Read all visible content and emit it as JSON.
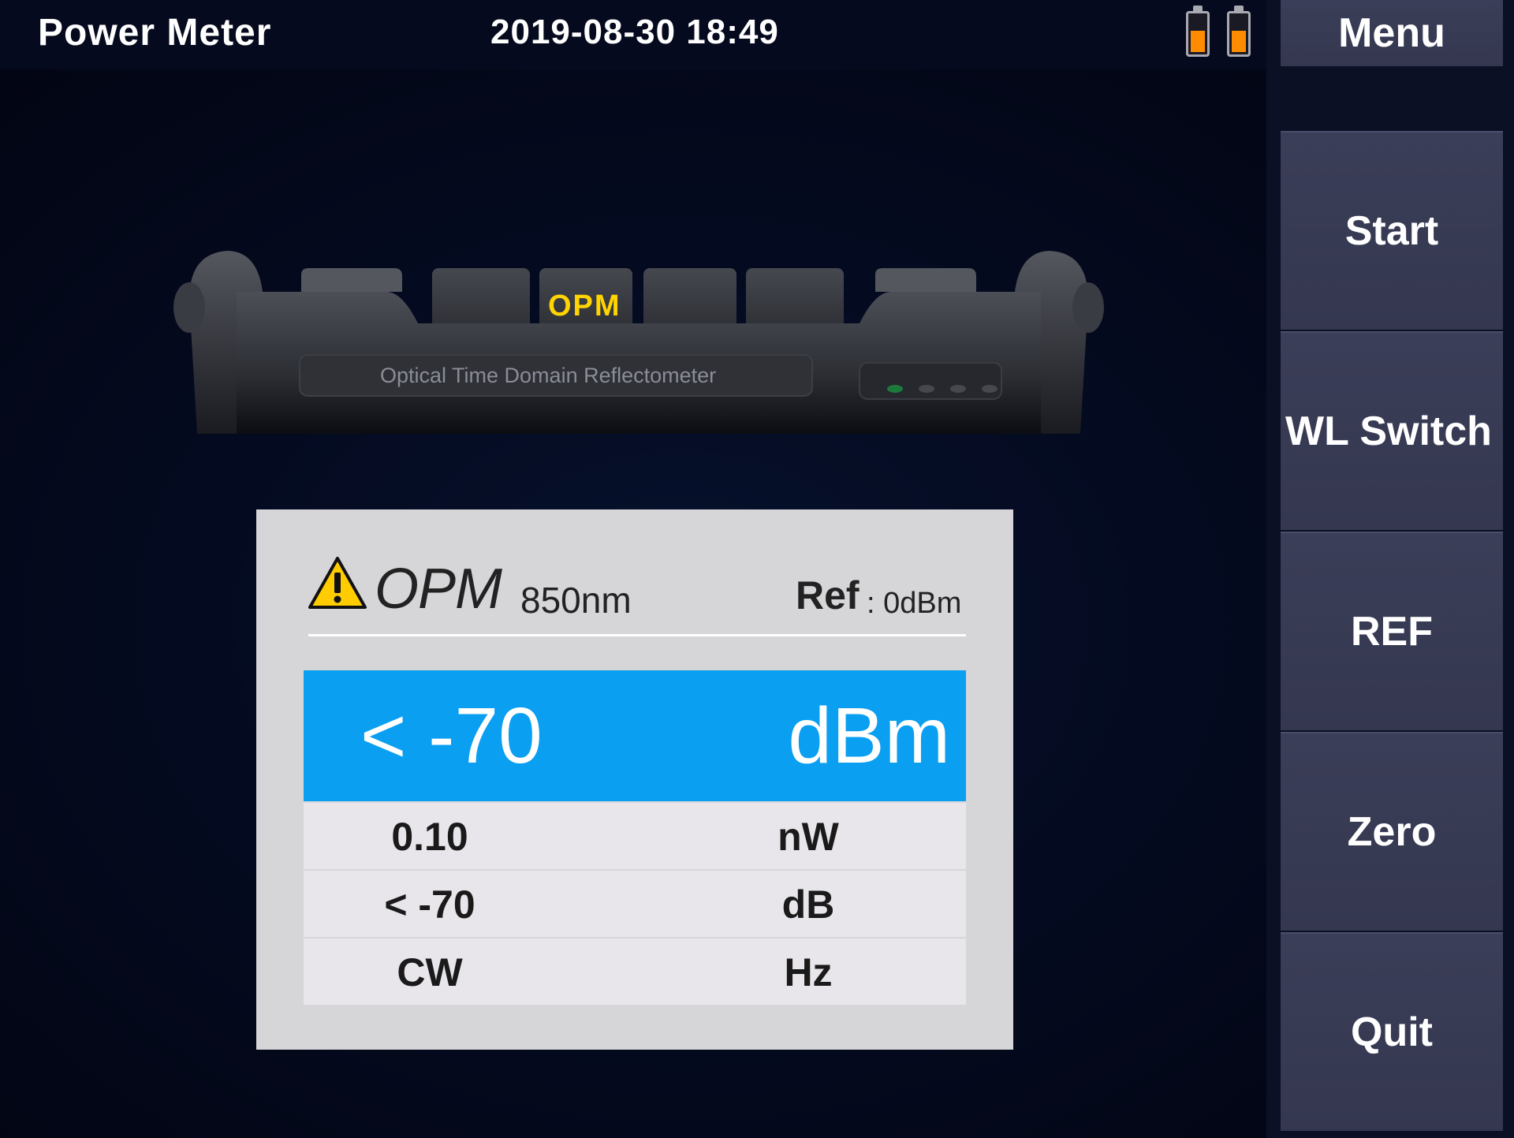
{
  "header": {
    "title": "Power Meter",
    "datetime": "2019-08-30 18:49",
    "battery_icons": [
      "battery-icon",
      "battery-icon"
    ],
    "battery_color": "#ff8c00"
  },
  "sidebar": {
    "menu_label": "Menu",
    "buttons": [
      {
        "label": "Start"
      },
      {
        "label": "WL Switch"
      },
      {
        "label": "REF"
      },
      {
        "label": "Zero"
      },
      {
        "label": "Quit"
      }
    ]
  },
  "device": {
    "mode_label": "OPM",
    "caption": "Optical Time Domain Reflectometer"
  },
  "meter": {
    "mode": "OPM",
    "wavelength": "850nm",
    "ref_label": "Ref",
    "ref_value": ": 0dBm",
    "warning_icon": "warning-icon",
    "primary": {
      "value": "< -70",
      "unit": "dBm"
    },
    "rows": [
      {
        "value": "0.10",
        "unit": "nW"
      },
      {
        "value": "< -70",
        "unit": "dB"
      },
      {
        "value": "CW",
        "unit": "Hz"
      }
    ],
    "accent_color": "#0a9ff0"
  }
}
